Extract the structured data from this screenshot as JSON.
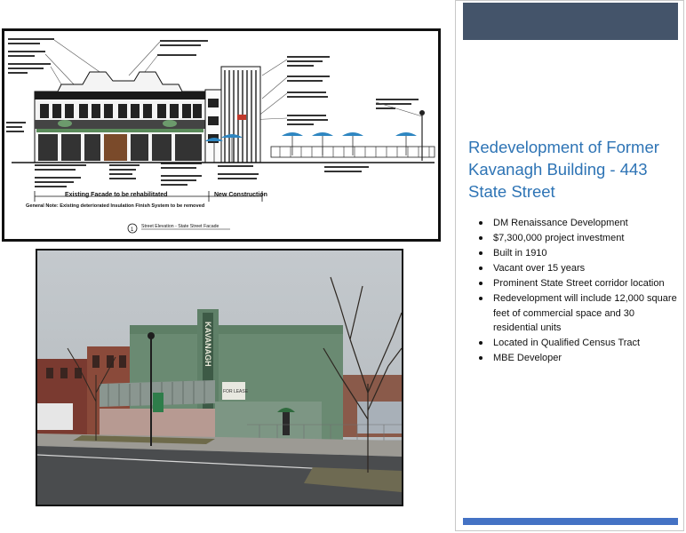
{
  "slide": {
    "title": "Redevelopment of Former Kavanagh Building - 443 State Street",
    "bullets": [
      "DM Renaissance Development",
      "$7,300,000 project investment",
      "Built in 1910",
      "Vacant over 15 years",
      "Prominent State Street corridor location",
      "Redevelopment will include 12,000 square feet of commercial space and 30 residential units",
      "Located in Qualified Census Tract",
      "MBE Developer"
    ]
  },
  "elevation_drawing": {
    "existing_label": "Existing Facade to be rehabilitated",
    "new_label": "New Construction",
    "general_note": "General Note: Existing deteriorated Insulation Finish System to be removed",
    "drawing_title": "Street Elevation - State Street Facade",
    "drawing_number": "1"
  },
  "photo": {
    "vertical_sign": "KAVANAGH",
    "window_sign": "FOR LEASE"
  },
  "colors": {
    "header_band": "#44546a",
    "footer_band": "#4472c4",
    "title_text": "#2e74b5"
  }
}
